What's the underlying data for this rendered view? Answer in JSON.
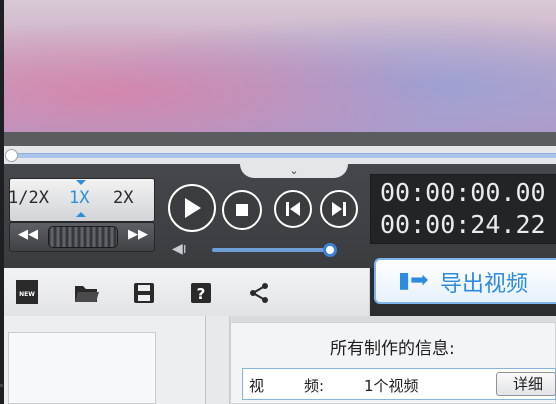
{
  "player": {
    "speed_options": [
      "1/2X",
      "1X",
      "2X"
    ],
    "active_speed": "1X",
    "timecode_current": "00:00:00.00",
    "timecode_total": "00:00:24.22",
    "volume_fraction": 0.95,
    "progress_fraction": 0.0
  },
  "export": {
    "label": "导出视频"
  },
  "toolbar": {
    "new_icon_label": "NEW"
  },
  "info": {
    "title": "所有制作的信息:",
    "row_label_1": "视",
    "row_label_2": "频:",
    "row_value": "1个视频",
    "detail_button": "详细"
  },
  "colors": {
    "accent": "#2d8be0",
    "deck": "#3f4145",
    "timecode_bg": "#232427"
  }
}
